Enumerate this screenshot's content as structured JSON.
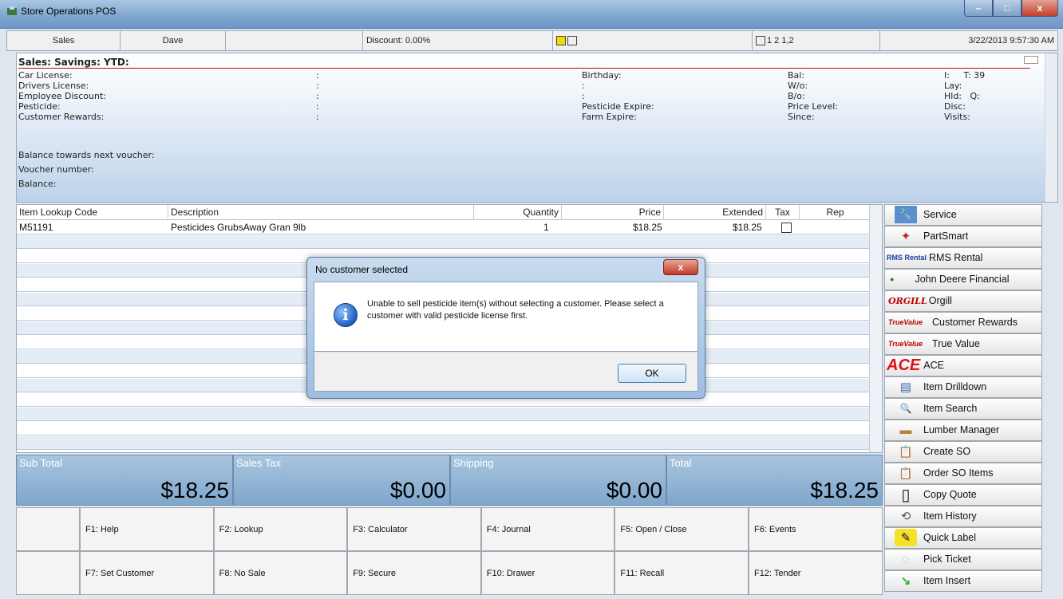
{
  "window": {
    "title": "Store Operations POS",
    "minimize_glyph": "–",
    "maximize_glyph": "□",
    "close_glyph": "x"
  },
  "statusbar": {
    "mode": "Sales",
    "cashier": "Dave",
    "discount": "Discount: 0.00%",
    "register_info": "1  2  1,2",
    "datetime": "3/22/2013 9:57:30 AM"
  },
  "customer": {
    "header": "Sales:  Savings:  YTD:",
    "left_labels": [
      "Car License:",
      "Drivers License:",
      "Employee Discount:",
      "Pesticide:",
      "Customer Rewards:"
    ],
    "colons": [
      ":",
      ":",
      ":",
      ":",
      ":"
    ],
    "mid_labels": [
      "Birthday:",
      ":",
      ":",
      "Pesticide Expire:",
      "Farm Expire:"
    ],
    "right_labels": [
      "Bal:",
      "W/o:",
      "B/o:",
      "Price Level:",
      "Since:"
    ],
    "far_labels": [
      "I:     T: 39",
      "Lay:",
      "Hld:   Q:",
      "Disc:",
      "Visits:"
    ],
    "voucher_labels": [
      "Balance towards next voucher:",
      "Voucher number:",
      "Balance:"
    ]
  },
  "grid": {
    "headers": [
      "Item Lookup Code",
      "Description",
      "Quantity",
      "Price",
      "Extended",
      "Tax",
      "Rep"
    ],
    "rows": [
      {
        "code": "M51191",
        "description": "Pesticides GrubsAway Gran 9lb",
        "quantity": "1",
        "price": "$18.25",
        "extended": "$18.25"
      }
    ]
  },
  "totals": [
    {
      "label": "Sub Total",
      "value": "$18.25"
    },
    {
      "label": "Sales Tax",
      "value": "$0.00"
    },
    {
      "label": "Shipping",
      "value": "$0.00"
    },
    {
      "label": "Total",
      "value": "$18.25"
    }
  ],
  "fkeys": {
    "row1": [
      "F1: Help",
      "F2: Lookup",
      "F3: Calculator",
      "F4: Journal",
      "F5: Open / Close",
      "F6: Events"
    ],
    "row2": [
      "F7: Set Customer",
      "F8: No Sale",
      "F9: Secure",
      "F10: Drawer",
      "F11: Recall",
      "F12: Tender"
    ]
  },
  "side_buttons": [
    {
      "label": "Service",
      "icon": "wrench-icon",
      "glyph": "🔧"
    },
    {
      "label": "PartSmart",
      "icon": "partsmart-icon",
      "glyph": "✦"
    },
    {
      "label": "RMS Rental",
      "icon": "rms-rental-logo",
      "glyph": "RMS Rental"
    },
    {
      "label": "John Deere Financial",
      "icon": "john-deere-logo",
      "glyph": "●"
    },
    {
      "label": "Orgill",
      "icon": "orgill-logo",
      "glyph": "ORGILL"
    },
    {
      "label": "Customer Rewards",
      "icon": "true-value-logo",
      "glyph": "TrueValue"
    },
    {
      "label": "True Value",
      "icon": "true-value-logo",
      "glyph": "TrueValue"
    },
    {
      "label": "ACE",
      "icon": "ace-logo",
      "glyph": "ACE"
    },
    {
      "label": "Item Drilldown",
      "icon": "drilldown-icon",
      "glyph": "▤"
    },
    {
      "label": "Item Search",
      "icon": "magnifier-icon",
      "glyph": "🔍"
    },
    {
      "label": "Lumber Manager",
      "icon": "lumber-icon",
      "glyph": "▬"
    },
    {
      "label": "Create SO",
      "icon": "clipboard-icon",
      "glyph": "📋"
    },
    {
      "label": "Order SO Items",
      "icon": "clipboard-icon",
      "glyph": "📋"
    },
    {
      "label": "Copy Quote",
      "icon": "document-icon",
      "glyph": "▯"
    },
    {
      "label": "Item History",
      "icon": "history-icon",
      "glyph": "⟲"
    },
    {
      "label": "Quick Label",
      "icon": "label-icon",
      "glyph": "✎"
    },
    {
      "label": "Pick Ticket",
      "icon": "ticket-icon",
      "glyph": "◌"
    },
    {
      "label": "Item Insert",
      "icon": "insert-icon",
      "glyph": "↘"
    }
  ],
  "dialog": {
    "title": "No customer selected",
    "message": "Unable to sell pesticide item(s) without selecting a customer. Please select a customer with valid pesticide license first.",
    "ok": "OK",
    "close_glyph": "x",
    "icon_glyph": "i"
  },
  "colors": {
    "accent_blue": "#7fa6cc",
    "header_rule": "#b01010"
  }
}
